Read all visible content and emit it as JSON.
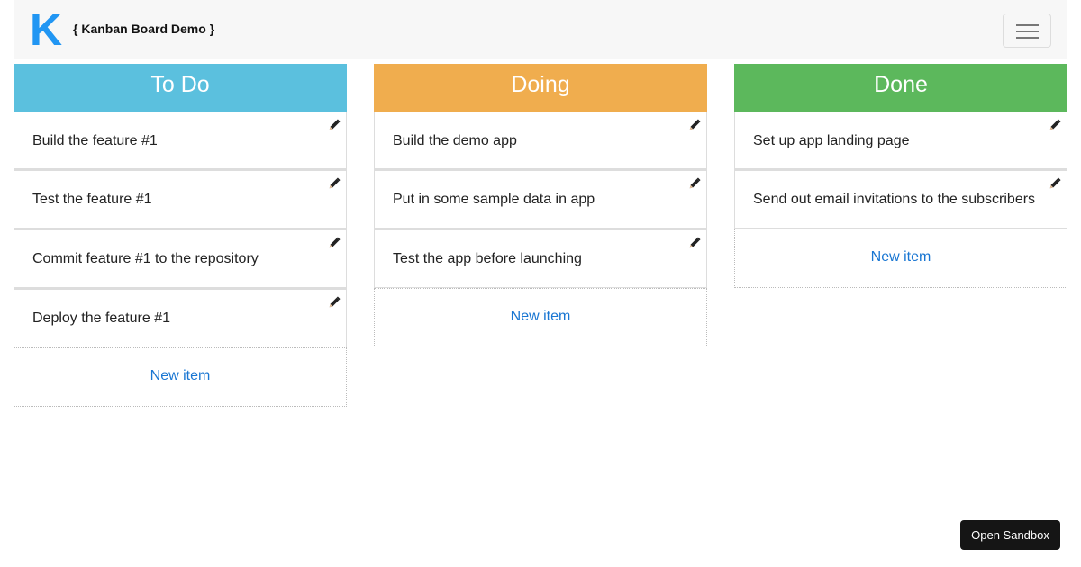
{
  "header": {
    "logo": "K",
    "brand": "{ Kanban Board Demo }"
  },
  "colors": {
    "todo": "#5bc0de",
    "doing": "#f0ad4e",
    "done": "#5cb85c",
    "link": "#1976d2",
    "logo": "#2196f3"
  },
  "columns": [
    {
      "title": "To Do",
      "items": [
        "Build the feature #1",
        "Test the feature #1",
        "Commit feature #1 to the repository",
        "Deploy the feature #1"
      ],
      "new_item": "New item"
    },
    {
      "title": "Doing",
      "items": [
        "Build the demo app",
        "Put in some sample data in app",
        "Test the app before launching"
      ],
      "new_item": "New item"
    },
    {
      "title": "Done",
      "items": [
        "Set up app landing page",
        "Send out email invitations to the subscribers"
      ],
      "new_item": "New item"
    }
  ],
  "sandbox_button": "Open Sandbox"
}
